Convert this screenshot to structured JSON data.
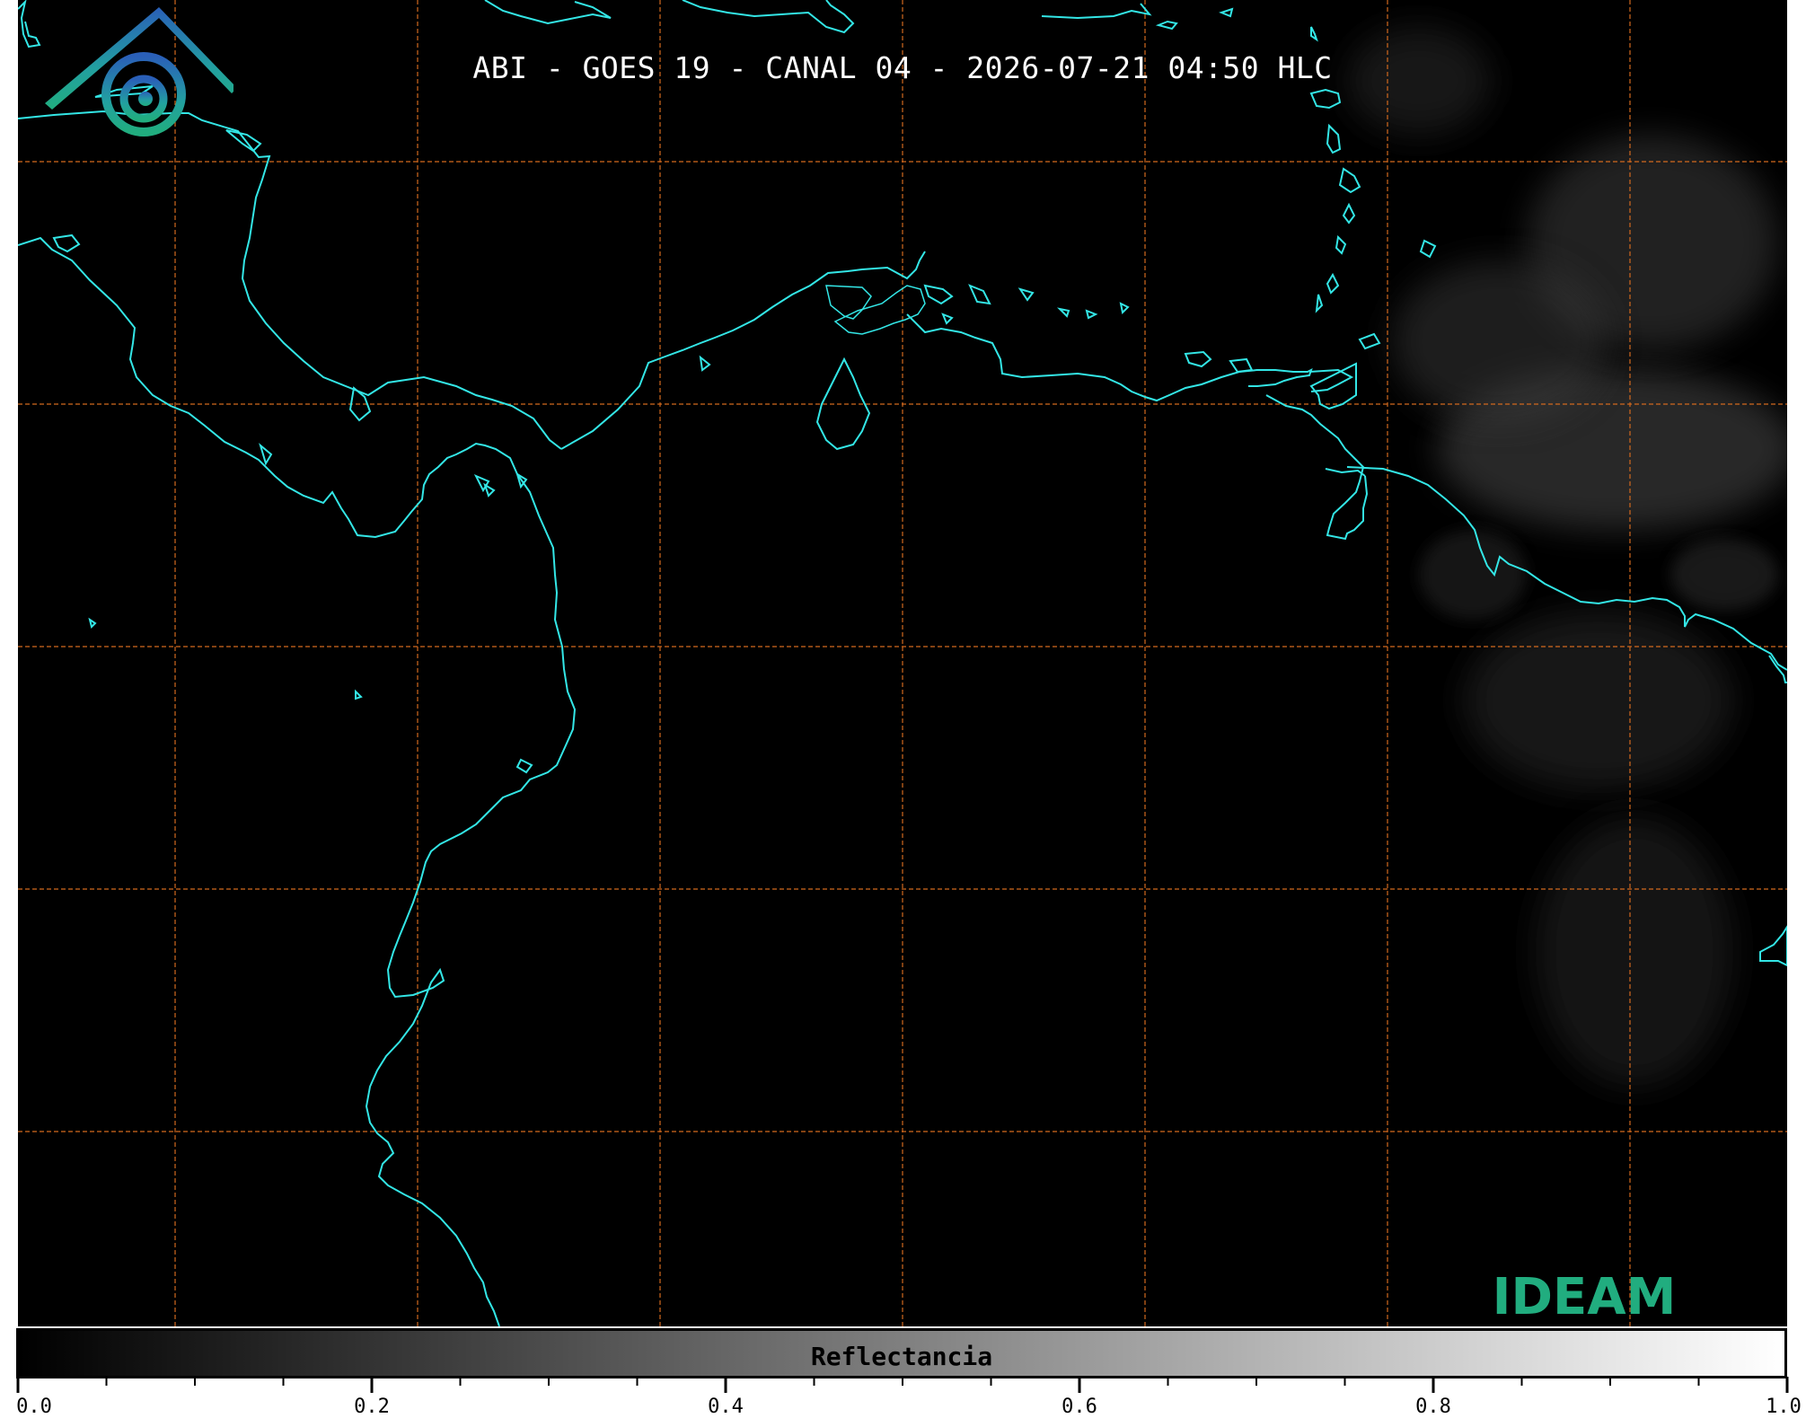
{
  "title": "ABI - GOES 19 - CANAL 04 - 2026-07-21 04:50 HLC",
  "logo": {
    "text": "IDEAM",
    "icon": "ideam-logo-icon"
  },
  "colorbar": {
    "label": "Reflectancia",
    "min": 0.0,
    "max": 1.0,
    "major_ticks": [
      "0.0",
      "0.2",
      "0.4",
      "0.6",
      "0.8",
      "1.0"
    ],
    "minor_step": 0.05,
    "colormap": "grayscale"
  },
  "map": {
    "gridline_color": "#d2691e",
    "coastline_color": "#33e6e6",
    "background_color": "#000000"
  }
}
